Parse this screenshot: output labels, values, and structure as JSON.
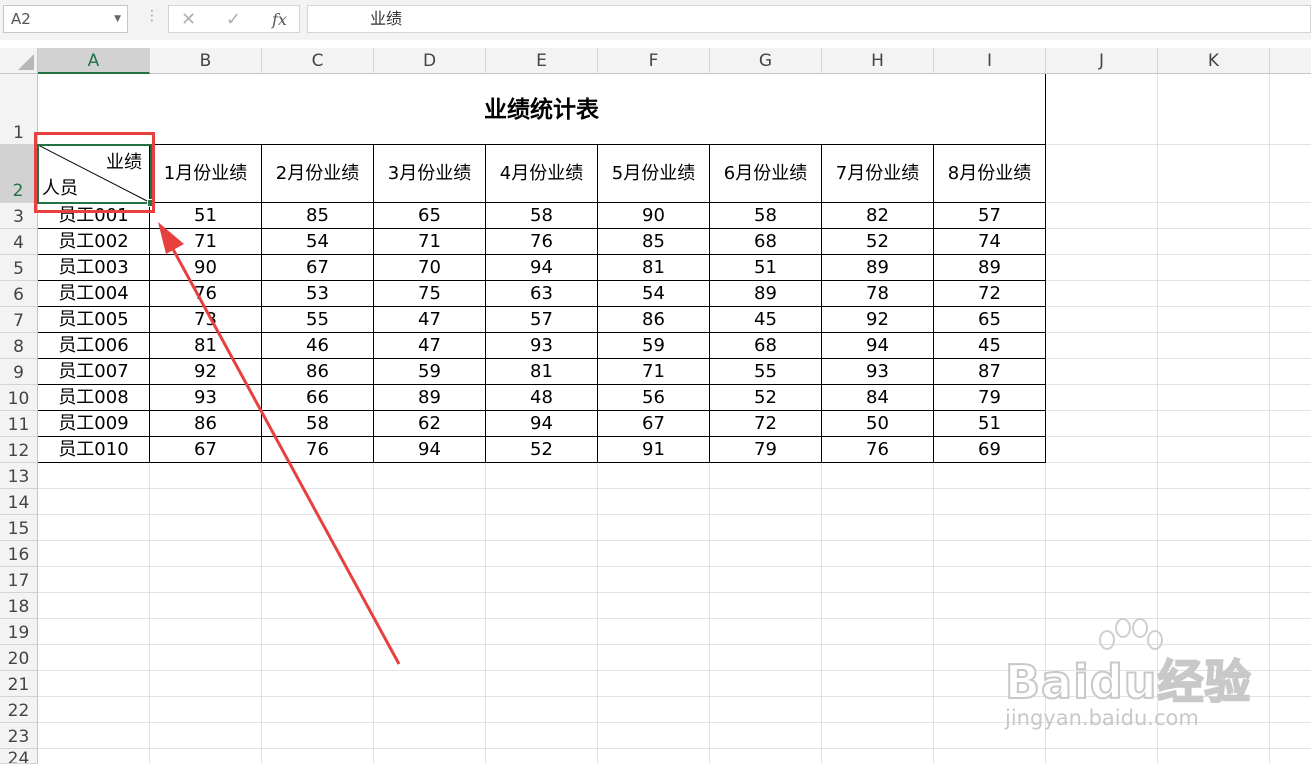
{
  "formula_bar": {
    "name_box": "A2",
    "cancel_glyph": "✕",
    "enter_glyph": "✓",
    "fx_label": "fx",
    "content": "业绩"
  },
  "columns": [
    "A",
    "B",
    "C",
    "D",
    "E",
    "F",
    "G",
    "H",
    "I",
    "J",
    "K"
  ],
  "row_numbers": [
    "1",
    "2",
    "3",
    "4",
    "5",
    "6",
    "7",
    "8",
    "9",
    "10",
    "11",
    "12",
    "13",
    "14",
    "15",
    "16",
    "17",
    "18",
    "19",
    "20",
    "21",
    "22",
    "23",
    "24"
  ],
  "table": {
    "title": "业绩统计表",
    "corner_top": "业绩",
    "corner_bottom": "人员",
    "month_headers": [
      "1月份业绩",
      "2月份业绩",
      "3月份业绩",
      "4月份业绩",
      "5月份业绩",
      "6月份业绩",
      "7月份业绩",
      "8月份业绩"
    ],
    "rows": [
      {
        "name": "员工001",
        "values": [
          "51",
          "85",
          "65",
          "58",
          "90",
          "58",
          "82",
          "57"
        ]
      },
      {
        "name": "员工002",
        "values": [
          "71",
          "54",
          "71",
          "76",
          "85",
          "68",
          "52",
          "74"
        ]
      },
      {
        "name": "员工003",
        "values": [
          "90",
          "67",
          "70",
          "94",
          "81",
          "51",
          "89",
          "89"
        ]
      },
      {
        "name": "员工004",
        "values": [
          "76",
          "53",
          "75",
          "63",
          "54",
          "89",
          "78",
          "72"
        ]
      },
      {
        "name": "员工005",
        "values": [
          "73",
          "55",
          "47",
          "57",
          "86",
          "45",
          "92",
          "65"
        ]
      },
      {
        "name": "员工006",
        "values": [
          "81",
          "46",
          "47",
          "93",
          "59",
          "68",
          "94",
          "45"
        ]
      },
      {
        "name": "员工007",
        "values": [
          "92",
          "86",
          "59",
          "81",
          "71",
          "55",
          "93",
          "87"
        ]
      },
      {
        "name": "员工008",
        "values": [
          "93",
          "66",
          "89",
          "48",
          "56",
          "52",
          "84",
          "79"
        ]
      },
      {
        "name": "员工009",
        "values": [
          "86",
          "58",
          "62",
          "94",
          "67",
          "72",
          "50",
          "51"
        ]
      },
      {
        "name": "员工010",
        "values": [
          "67",
          "76",
          "94",
          "52",
          "91",
          "79",
          "76",
          "69"
        ]
      }
    ]
  },
  "watermark": {
    "brand": "Baidu经验",
    "url": "jingyan.baidu.com"
  },
  "colors": {
    "selection": "#217346",
    "annotation": "#e8403f"
  }
}
